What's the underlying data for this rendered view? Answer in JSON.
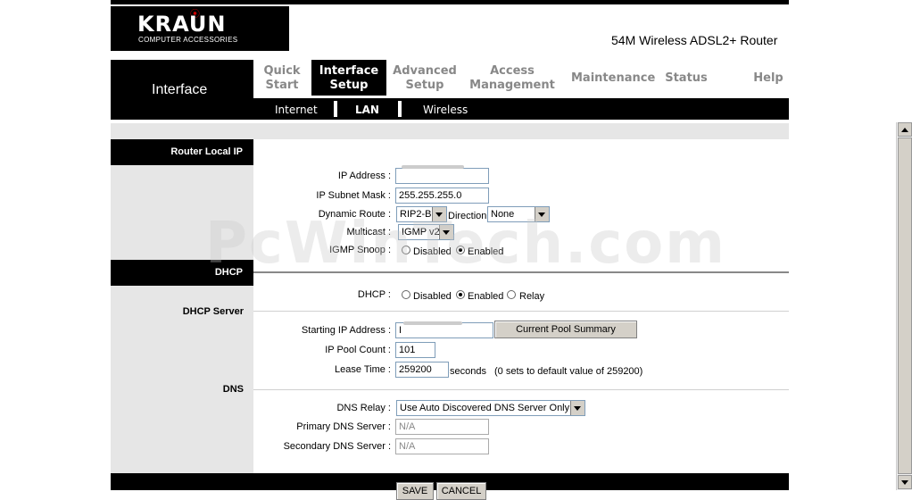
{
  "header": {
    "logo_text": "KRAUN",
    "logo_sub": "COMPUTER ACCESSORIES",
    "product": "54M Wireless ADSL2+ Router"
  },
  "nav": {
    "section_label": "Interface",
    "items": [
      {
        "line1": "Quick",
        "line2": "Start"
      },
      {
        "line1": "Interface",
        "line2": "Setup"
      },
      {
        "line1": "Advanced",
        "line2": "Setup"
      },
      {
        "line1": "Access",
        "line2": "Management"
      },
      {
        "line1": "Maintenance",
        "line2": ""
      },
      {
        "line1": "Status",
        "line2": ""
      },
      {
        "line1": "Help",
        "line2": ""
      }
    ],
    "sub_items": [
      "Internet",
      "LAN",
      "Wireless"
    ]
  },
  "router_local_ip": {
    "section": "Router Local IP",
    "ip_address_label": "IP Address :",
    "ip_address_value": "",
    "subnet_label": "IP Subnet Mask :",
    "subnet_value": "255.255.255.0",
    "dynamic_route_label": "Dynamic Route :",
    "dynamic_route_value": "RIP2-B",
    "direction_label": "Direction",
    "direction_value": "None",
    "multicast_label": "Multicast :",
    "multicast_value": "IGMP v2",
    "igmp_snoop_label": "IGMP Snoop :",
    "disabled": "Disabled",
    "enabled": "Enabled"
  },
  "dhcp": {
    "section": "DHCP",
    "dhcp_label": "DHCP :",
    "disabled": "Disabled",
    "enabled": "Enabled",
    "relay": "Relay",
    "server_section": "DHCP Server",
    "start_ip_label": "Starting IP Address :",
    "start_ip_value": "I",
    "pool_button": "Current Pool Summary",
    "pool_count_label": "IP Pool Count :",
    "pool_count_value": "101",
    "lease_label": "Lease Time :",
    "lease_value": "259200",
    "lease_unit": "seconds",
    "lease_note": "(0 sets to default value of 259200)"
  },
  "dns": {
    "section": "DNS",
    "relay_label": "DNS Relay :",
    "relay_value": "Use Auto Discovered DNS Server Only",
    "primary_label": "Primary DNS Server :",
    "primary_value": "N/A",
    "secondary_label": "Secondary DNS Server :",
    "secondary_value": "N/A"
  },
  "footer": {
    "save": "SAVE",
    "cancel": "CANCEL"
  },
  "watermark": "PcWinTech.com"
}
